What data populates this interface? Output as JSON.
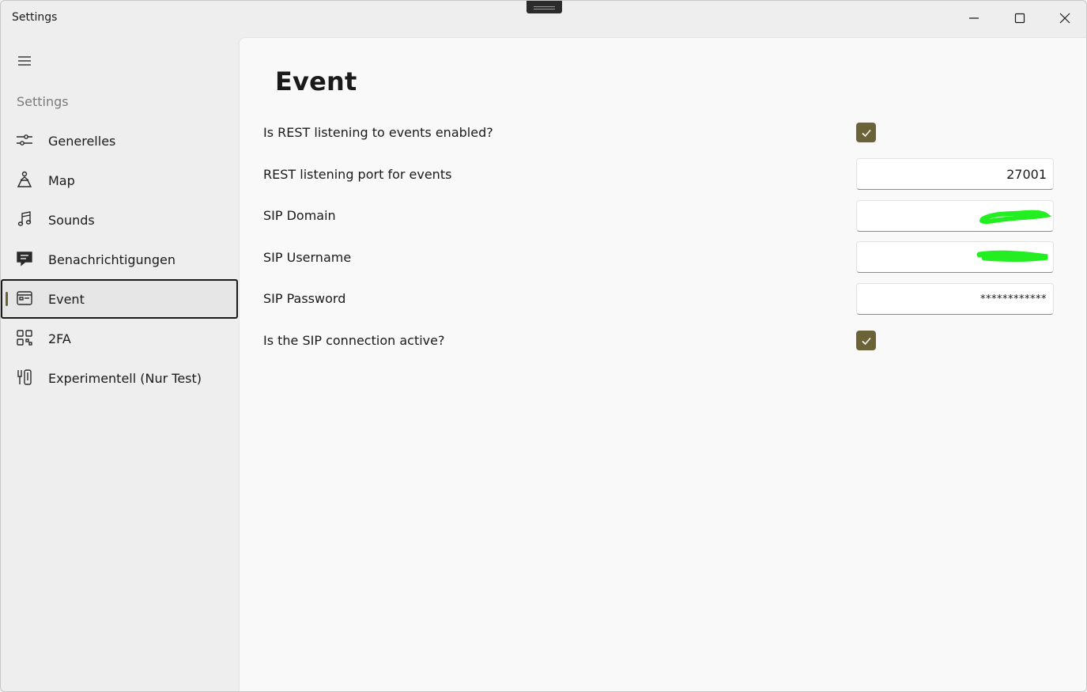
{
  "window": {
    "title": "Settings"
  },
  "sidebar": {
    "header": "Settings",
    "items": [
      {
        "label": "Generelles",
        "icon": "sliders-icon"
      },
      {
        "label": "Map",
        "icon": "map-person-icon"
      },
      {
        "label": "Sounds",
        "icon": "music-note-icon"
      },
      {
        "label": "Benachrichtigungen",
        "icon": "message-icon"
      },
      {
        "label": "Event",
        "icon": "calendar-event-icon",
        "selected": true
      },
      {
        "label": "2FA",
        "icon": "qr-code-icon"
      },
      {
        "label": "Experimentell (Nur Test)",
        "icon": "experiment-icon"
      }
    ]
  },
  "main": {
    "title": "Event",
    "settings": [
      {
        "label": "Is REST listening to events enabled?",
        "type": "checkbox",
        "checked": true
      },
      {
        "label": "REST listening port for events",
        "type": "text",
        "value": "27001"
      },
      {
        "label": "SIP Domain",
        "type": "text",
        "value": ""
      },
      {
        "label": "SIP Username",
        "type": "text",
        "value": ""
      },
      {
        "label": "SIP Password",
        "type": "password",
        "value": "************"
      },
      {
        "label": "Is the SIP connection active?",
        "type": "checkbox",
        "checked": true
      }
    ]
  },
  "colors": {
    "accent": "#6b6238",
    "redaction": "#22ee22"
  }
}
